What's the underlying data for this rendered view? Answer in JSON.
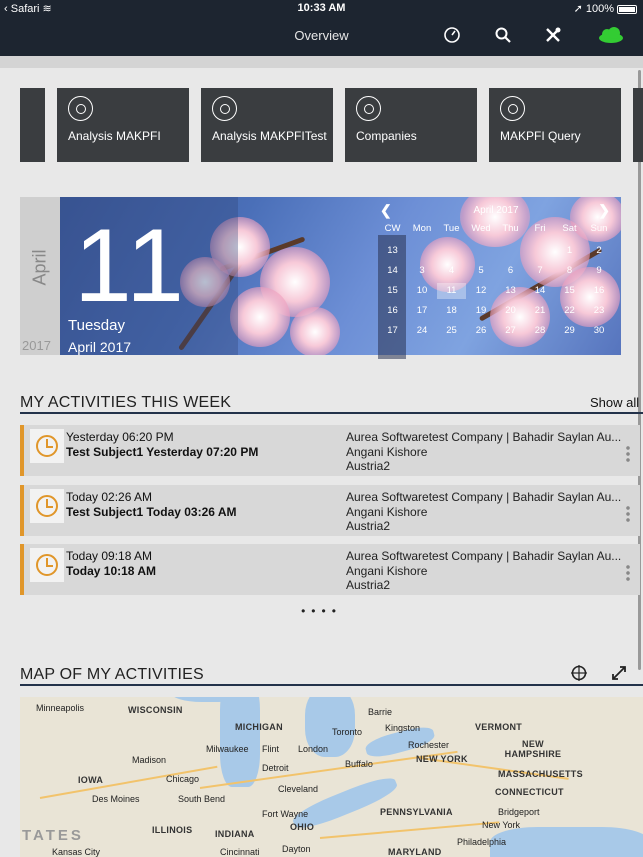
{
  "status_bar": {
    "left": "Safari",
    "time": "10:33 AM",
    "battery": "100%"
  },
  "nav": {
    "title": "Overview"
  },
  "tiles": [
    {
      "label": "Analysis MAKPFI"
    },
    {
      "label": "Analysis MAKPFITest"
    },
    {
      "label": "Companies"
    },
    {
      "label": "MAKPFI Query"
    }
  ],
  "calendar": {
    "side_month": "April",
    "side_year": "2017",
    "day": "11",
    "weekday": "Tuesday",
    "month_year": "April 2017",
    "header": "April 2017",
    "columns": [
      "CW",
      "Mon",
      "Tue",
      "Wed",
      "Thu",
      "Fri",
      "Sat",
      "Sun"
    ],
    "weeks": [
      [
        "13",
        "",
        "",
        "",
        "",
        "",
        "1",
        "2"
      ],
      [
        "14",
        "3",
        "4",
        "5",
        "6",
        "7",
        "8",
        "9"
      ],
      [
        "15",
        "10",
        "11",
        "12",
        "13",
        "14",
        "15",
        "16"
      ],
      [
        "16",
        "17",
        "18",
        "19",
        "20",
        "21",
        "22",
        "23"
      ],
      [
        "17",
        "24",
        "25",
        "26",
        "27",
        "28",
        "29",
        "30"
      ]
    ],
    "accent": "#4a6fb8"
  },
  "activities_section": {
    "title": "MY ACTIVITIES THIS WEEK",
    "show_all": "Show all"
  },
  "activities": [
    {
      "start": "Yesterday 06:20 PM",
      "subject": "Test Subject1 Yesterday 07:20 PM",
      "company": "Aurea Softwaretest Company | Bahadir Saylan Au...",
      "person": "Angani Kishore",
      "location": "Austria2"
    },
    {
      "start": "Today 02:26 AM",
      "subject": "Test Subject1 Today 03:26 AM",
      "company": "Aurea Softwaretest Company | Bahadir Saylan Au...",
      "person": "Angani Kishore",
      "location": "Austria2"
    },
    {
      "start": "Today 09:18 AM",
      "subject": "Today 10:18 AM",
      "company": "Aurea Softwaretest Company | Bahadir Saylan Au...",
      "person": "Angani Kishore",
      "location": "Austria2"
    }
  ],
  "pager": "••••",
  "map_section": {
    "title": "MAP OF MY ACTIVITIES"
  },
  "map": {
    "states": [
      "WISCONSIN",
      "MICHIGAN",
      "IOWA",
      "ILLINOIS",
      "INDIANA",
      "OHIO",
      "PENNSYLVANIA",
      "NEW YORK",
      "VERMONT",
      "NEW HAMPSHIRE",
      "MASSACHUSETTS",
      "CONNECTICUT",
      "MARYLAND",
      "TATES"
    ],
    "cities": [
      "Minneapolis",
      "Milwaukee",
      "Madison",
      "Chicago",
      "Des Moines",
      "South Bend",
      "Flint",
      "London",
      "Detroit",
      "Toronto",
      "Barrie",
      "Kingston",
      "Rochester",
      "Buffalo",
      "Cleveland",
      "Fort Wayne",
      "Dayton",
      "Cincinnati",
      "Kansas City",
      "Bridgeport",
      "New York",
      "Philadelphia"
    ]
  },
  "colors": {
    "nav_bg": "#1d2530",
    "activity_accent": "#e0962a",
    "cloud": "#33cc33"
  }
}
